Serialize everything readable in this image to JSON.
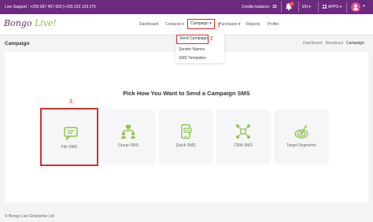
{
  "topbar": {
    "support": "Live Support : +255 687 457 652 |+255 222 129 275",
    "credits_label": "Credits balance:",
    "credits_value": "33",
    "notifications_count": "0",
    "language": "EN ▾",
    "apps_label": "APPS ▾",
    "user_caret": "▾"
  },
  "logo": {
    "text_main": "Bongo ",
    "text_accent": "Live!"
  },
  "nav": {
    "dashboard": "Dashboard",
    "contacts": "Contacts ▾",
    "campaign": "Campaign ▾",
    "purchases": "Purchases ▾",
    "reports": "Reports",
    "profile": "Profile"
  },
  "annotations": {
    "one": "1",
    "two": "2",
    "three": "3."
  },
  "dropdown": {
    "items": [
      "Send Campaign",
      "Sender Names",
      "SMS Templates"
    ]
  },
  "page": {
    "title": "Campaign",
    "breadcrumb": [
      "Dashboard",
      "Broadcast",
      "Campaign"
    ]
  },
  "main": {
    "heading": "Pick How You Want to Send a Campaign SMS",
    "cards": [
      {
        "label": "File SMS",
        "icon": "chat-icon"
      },
      {
        "label": "Group SMS",
        "icon": "group-icon"
      },
      {
        "label": "Quick SMS",
        "icon": "phone-icon"
      },
      {
        "label": "CRM SMS",
        "icon": "network-icon"
      },
      {
        "label": "Target Segments",
        "icon": "target-icon"
      }
    ]
  },
  "footer": {
    "text": "© Bongo Live Enterprise Ltd"
  },
  "colors": {
    "brand": "#6b2a7e",
    "accent": "#8bc34a",
    "annotation": "#d32f2f",
    "badge": "#e53935"
  }
}
